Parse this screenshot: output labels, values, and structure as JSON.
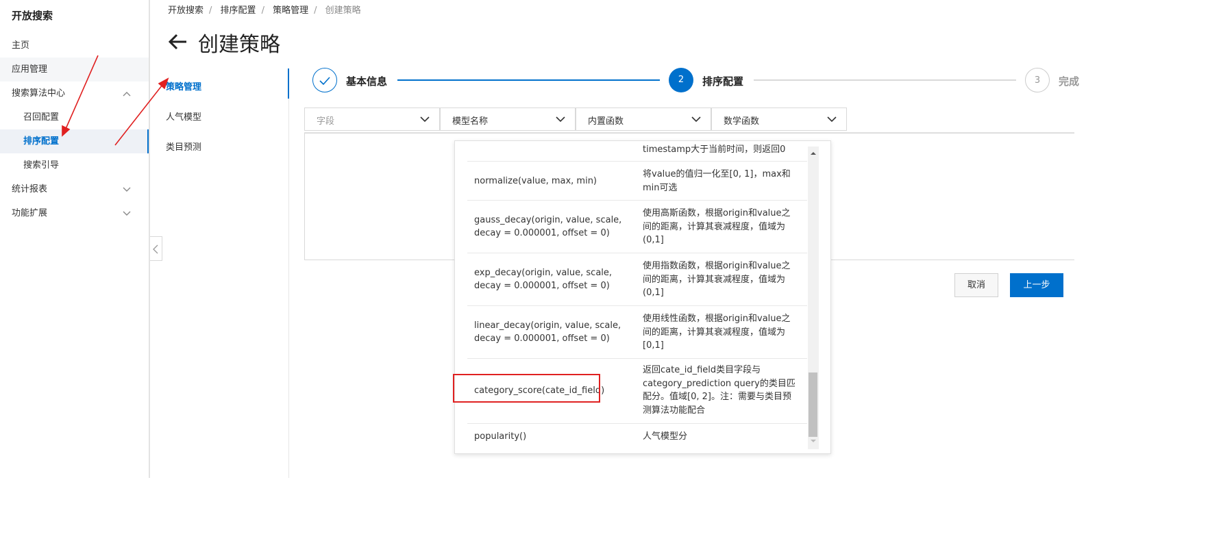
{
  "app": {
    "title": "开放搜索"
  },
  "sidebar": {
    "items": [
      {
        "label": "主页"
      },
      {
        "label": "应用管理"
      },
      {
        "label": "搜索算法中心"
      },
      {
        "label": "召回配置"
      },
      {
        "label": "排序配置"
      },
      {
        "label": "搜索引导"
      },
      {
        "label": "统计报表"
      },
      {
        "label": "功能扩展"
      }
    ]
  },
  "breadcrumb": [
    "开放搜索",
    "排序配置",
    "策略管理",
    "创建策略"
  ],
  "page": {
    "title": "创建策略"
  },
  "subnav": {
    "items": [
      {
        "label": "策略管理"
      },
      {
        "label": "人气模型"
      },
      {
        "label": "类目预测"
      }
    ]
  },
  "steps": [
    {
      "label": "基本信息",
      "state": "done"
    },
    {
      "number": "2",
      "label": "排序配置",
      "state": "current"
    },
    {
      "number": "3",
      "label": "完成",
      "state": "todo"
    }
  ],
  "dropdowns": [
    {
      "label": "字段",
      "placeholder": true
    },
    {
      "label": "模型名称"
    },
    {
      "label": "内置函数"
    },
    {
      "label": "数学函数"
    }
  ],
  "functions": {
    "rows": [
      {
        "fn": "",
        "desc": "timestamp大于当前时间，则返回0"
      },
      {
        "fn": "normalize(value, max, min)",
        "desc": "将value的值归一化至[0, 1]，max和min可选"
      },
      {
        "fn": "gauss_decay(origin, value, scale, decay = 0.000001, offset = 0)",
        "desc": "使用高斯函数，根据origin和value之间的距离，计算其衰减程度，值域为(0,1]"
      },
      {
        "fn": "exp_decay(origin, value, scale, decay = 0.000001, offset = 0)",
        "desc": "使用指数函数，根据origin和value之间的距离，计算其衰减程度，值域为(0,1]"
      },
      {
        "fn": "linear_decay(origin, value, scale, decay = 0.000001, offset = 0)",
        "desc": "使用线性函数，根据origin和value之间的距离，计算其衰减程度，值域为[0,1]"
      },
      {
        "fn": "category_score(cate_id_field)",
        "desc": "返回cate_id_field类目字段与category_prediction query的类目匹配分。值域[0, 2]。注：需要与类目预测算法功能配合"
      },
      {
        "fn": "popularity()",
        "desc": "人气模型分"
      }
    ]
  },
  "buttons": {
    "cancel": "取消",
    "prev": "上一步"
  },
  "colors": {
    "primary": "#0070cc",
    "annotation": "#e02020"
  },
  "icons": [
    "back-arrow-icon",
    "chevron-up-icon",
    "chevron-down-icon",
    "check-icon",
    "chevron-left-icon"
  ]
}
